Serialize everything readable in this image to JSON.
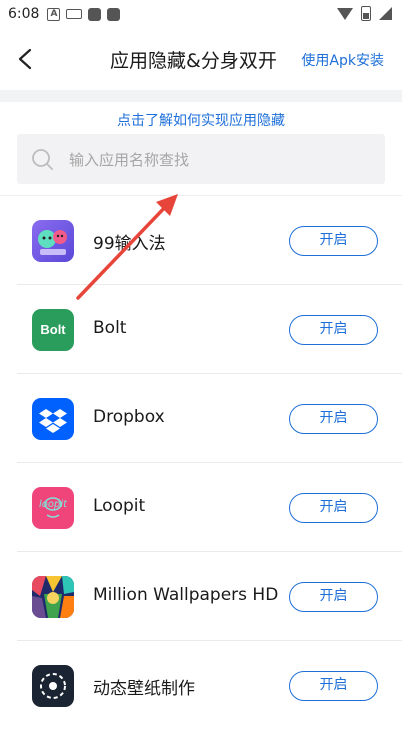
{
  "status_bar": {
    "time": "6:08",
    "notif_a": "A"
  },
  "header": {
    "title": "应用隐藏&分身双开",
    "action": "使用Apk安装"
  },
  "info_link": "点击了解如何实现应用隐藏",
  "search": {
    "placeholder": "输入应用名称查找"
  },
  "apps": [
    {
      "name": "99输入法",
      "button": "开启",
      "icon": "keyboard-emoji-icon"
    },
    {
      "name": "Bolt",
      "button": "开启",
      "icon_text": "Bolt",
      "icon": "bolt-app-icon"
    },
    {
      "name": "Dropbox",
      "button": "开启",
      "icon": "dropbox-app-icon"
    },
    {
      "name": "Loopit",
      "button": "开启",
      "icon_text": "loopit",
      "icon": "loopit-app-icon"
    },
    {
      "name": "Million Wallpapers HD",
      "button": "开启",
      "icon": "wallpapers-app-icon"
    },
    {
      "name": "动态壁纸制作",
      "button": "开启",
      "icon": "live-wallpaper-maker-icon"
    }
  ],
  "colors": {
    "accent": "#1e6fd9",
    "arrow": "#e8453a",
    "bolt_bg": "#2a9d5c",
    "dropbox_bg": "#0061fe",
    "loopit_bg": "#f0457a"
  }
}
